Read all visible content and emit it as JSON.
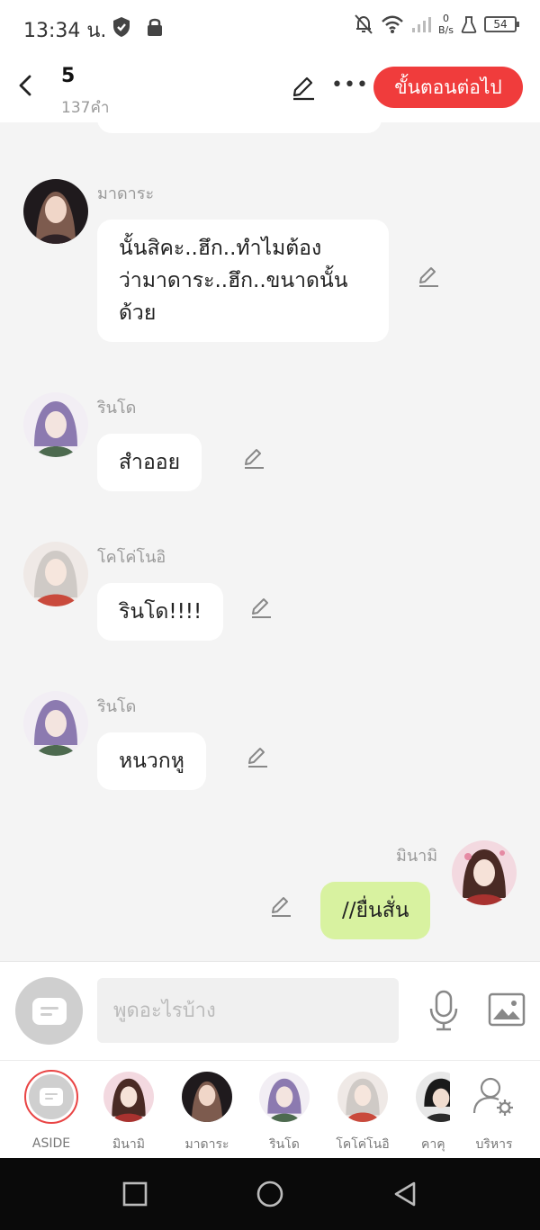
{
  "status_bar": {
    "time": "13:34 น.",
    "speed_value": "0",
    "speed_unit": "B/s",
    "battery": "54",
    "icons": [
      "shield-icon",
      "lock-icon",
      "bell-off-icon",
      "wifi-icon",
      "signal-icon",
      "flask-icon",
      "battery-icon"
    ]
  },
  "header": {
    "title": "5",
    "word_count": "137คำ",
    "next_button": "ขั้นตอนต่อไป",
    "icons": [
      "back-arrow-icon",
      "pencil-icon",
      "more-icon"
    ]
  },
  "messages": [
    {
      "sender": "มาดาระ",
      "lines": [
        "นั้นสิคะ..ฮึก..ทำไมต้อง",
        "ว่ามาดาระ..ฮึก..ขนาดนั้น",
        "ด้วย"
      ],
      "avatar_color": "#2a1e22"
    },
    {
      "sender": "รินโด",
      "lines": [
        "สำออย"
      ],
      "avatar_color": "#8c7ab0"
    },
    {
      "sender": "โคโค่โนอิ",
      "lines": [
        "รินโด!!!!"
      ],
      "avatar_color": "#c94a3c"
    },
    {
      "sender": "รินโด",
      "lines": [
        "หนวกหู"
      ],
      "avatar_color": "#8c7ab0"
    },
    {
      "sender": "มินามิ",
      "lines": [
        "//ยื่นสั่น"
      ],
      "avatar_color": "#a8322f",
      "mine": true
    }
  ],
  "composer": {
    "placeholder": "พูดอะไรบ้าง",
    "icons": [
      "aside-chat-icon",
      "microphone-icon",
      "image-icon"
    ]
  },
  "characters": [
    {
      "label": "ASIDE"
    },
    {
      "label": "มินามิ"
    },
    {
      "label": "มาดาระ"
    },
    {
      "label": "รินโด"
    },
    {
      "label": "โคโค่โนอิ"
    },
    {
      "label": "คาคุ"
    },
    {
      "label": "บริหาร"
    }
  ],
  "colors": {
    "accent": "#f03c3c",
    "my_bubble": "#d8f2a0",
    "background": "#f4f4f4"
  }
}
